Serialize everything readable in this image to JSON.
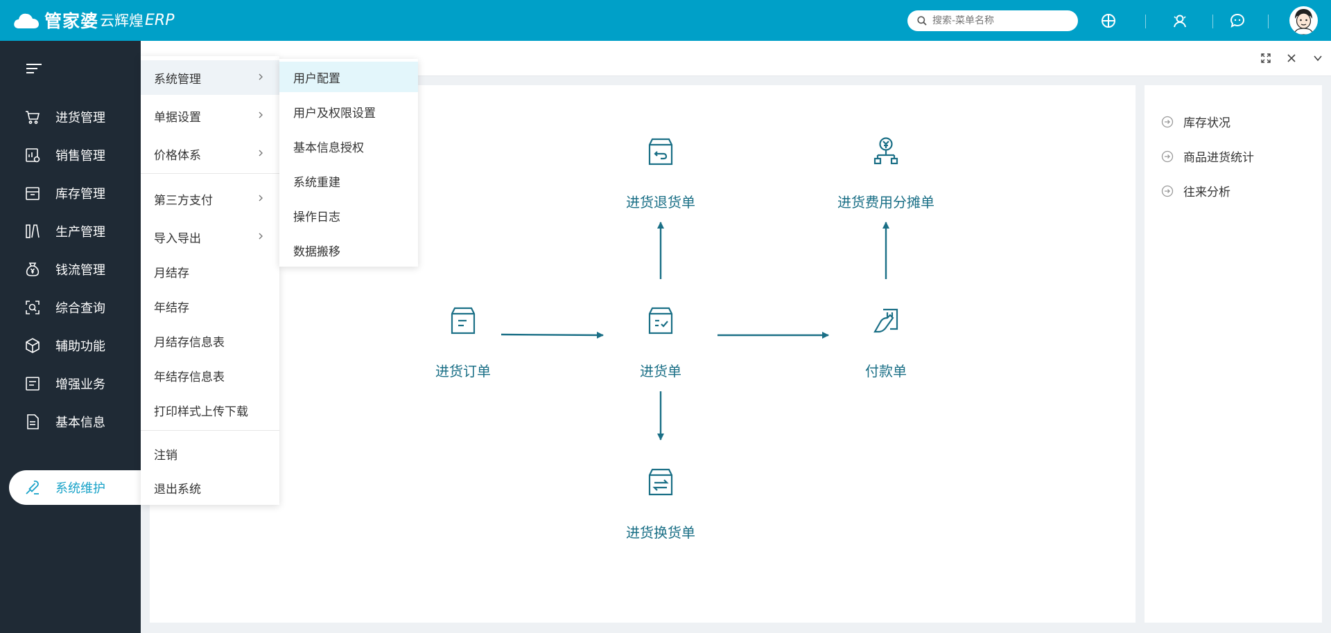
{
  "app": {
    "brand": "管家婆",
    "brand_sub": "云辉煌",
    "brand_erp": "ERP"
  },
  "search": {
    "placeholder": "搜索-菜单名称"
  },
  "header_icons": [
    "grid-icon",
    "service-icon",
    "chat-icon"
  ],
  "sidebar": {
    "items": [
      {
        "label": "进货管理",
        "icon": "cart-icon"
      },
      {
        "label": "销售管理",
        "icon": "sales-icon"
      },
      {
        "label": "库存管理",
        "icon": "inventory-icon"
      },
      {
        "label": "生产管理",
        "icon": "production-icon"
      },
      {
        "label": "钱流管理",
        "icon": "money-bag-icon"
      },
      {
        "label": "综合查询",
        "icon": "query-icon"
      },
      {
        "label": "辅助功能",
        "icon": "cube-icon"
      },
      {
        "label": "增强业务",
        "icon": "list-icon"
      },
      {
        "label": "基本信息",
        "icon": "document-icon"
      }
    ],
    "active_item": {
      "label": "系统维护",
      "icon": "wrench-icon"
    }
  },
  "menu_level1": {
    "items": [
      {
        "label": "系统管理",
        "has_sub": true
      },
      {
        "label": "单据设置",
        "has_sub": true
      },
      {
        "label": "价格体系",
        "has_sub": true
      },
      {
        "label": "第三方支付",
        "has_sub": true
      },
      {
        "label": "导入导出",
        "has_sub": true
      },
      {
        "label": "月结存",
        "has_sub": false
      },
      {
        "label": "年结存",
        "has_sub": false
      },
      {
        "label": "月结存信息表",
        "has_sub": false
      },
      {
        "label": "年结存信息表",
        "has_sub": false
      },
      {
        "label": "打印样式上传下载",
        "has_sub": false
      },
      {
        "label": "注销",
        "has_sub": false
      },
      {
        "label": "退出系统",
        "has_sub": false
      }
    ]
  },
  "menu_level2": {
    "items": [
      {
        "label": "用户配置"
      },
      {
        "label": "用户及权限设置"
      },
      {
        "label": "基本信息授权"
      },
      {
        "label": "系统重建"
      },
      {
        "label": "操作日志"
      },
      {
        "label": "数据搬移"
      }
    ]
  },
  "flow": {
    "purchase_order": "进货订单",
    "purchase": "进货单",
    "purchase_return": "进货退货单",
    "purchase_exchange": "进货换货单",
    "payment": "付款单",
    "cost_allocation": "进货费用分摊单"
  },
  "reports": [
    {
      "label": "库存状况"
    },
    {
      "label": "商品进货统计"
    },
    {
      "label": "往来分析"
    }
  ],
  "colors": {
    "topbar": "#00a0c8",
    "sidebar": "#1f2a35",
    "flow": "#1a6f86",
    "accent": "#17a2c8"
  }
}
